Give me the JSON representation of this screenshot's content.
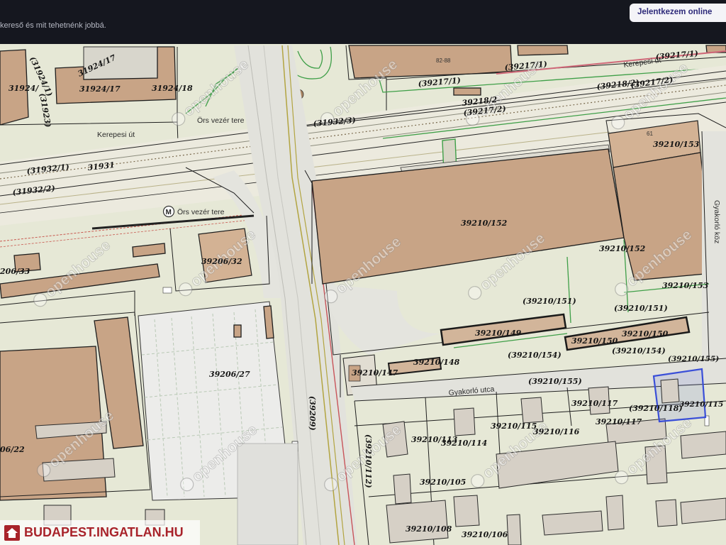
{
  "topbar": {
    "feedback_text": "kereső és mit tehetnénk jobbá.",
    "button_label": "Jelentkezem online"
  },
  "map": {
    "watermark": "openhouse",
    "site_logo": "BUDAPEST.INGATLAN.HU",
    "metro_icon": "M",
    "streets": {
      "kerepesi_1": "Kerepesi út",
      "kerepesi_2": "Kerepesi út",
      "ors_vezer_1": "Örs vezér tere",
      "ors_vezer_2": "Örs vezér tere",
      "gyakorlo_utca": "Gyakorló utca",
      "gyakorlo_koz": "Gyakorló köz"
    },
    "house_numbers": [
      "61",
      "82-88"
    ],
    "parcels": [
      "(31924/1)",
      "31924/",
      "(31923)",
      "31924/17",
      "31924/17",
      "31924/18",
      "(31932/3)",
      "(39217/1)",
      "(39217/1)",
      "(39217/1)",
      "(39218/2)",
      "(39217/2)",
      "39218/2",
      "(39217/2)",
      "(31932/1)",
      "31931",
      "(31932/2)",
      "39210/153",
      "39210/152",
      "39210/152",
      "39210/153",
      "39206/32",
      "206/33",
      "(39210/151)",
      "(39210/151)",
      "39210/149",
      "39210/150",
      "39210/150",
      "(39210/154)",
      "(39210/154)",
      "(39210/155)",
      "39210/148",
      "39210/147",
      "39206/27",
      "(39210/155)",
      "39210/117",
      "(39210/118)",
      "39210/115",
      "39210/117",
      "(39209)",
      "39210/115",
      "39210/116",
      "39210/113",
      "39210/114",
      "(39210/112)",
      "06/22",
      "39210/105",
      "39210/108",
      "39210/106"
    ]
  },
  "colors": {
    "topbar_bg": "#15171f",
    "button_text": "#2d2a7a",
    "building": "#c8a486",
    "selection": "#3a4fd8",
    "logo_red": "#a8232a"
  }
}
